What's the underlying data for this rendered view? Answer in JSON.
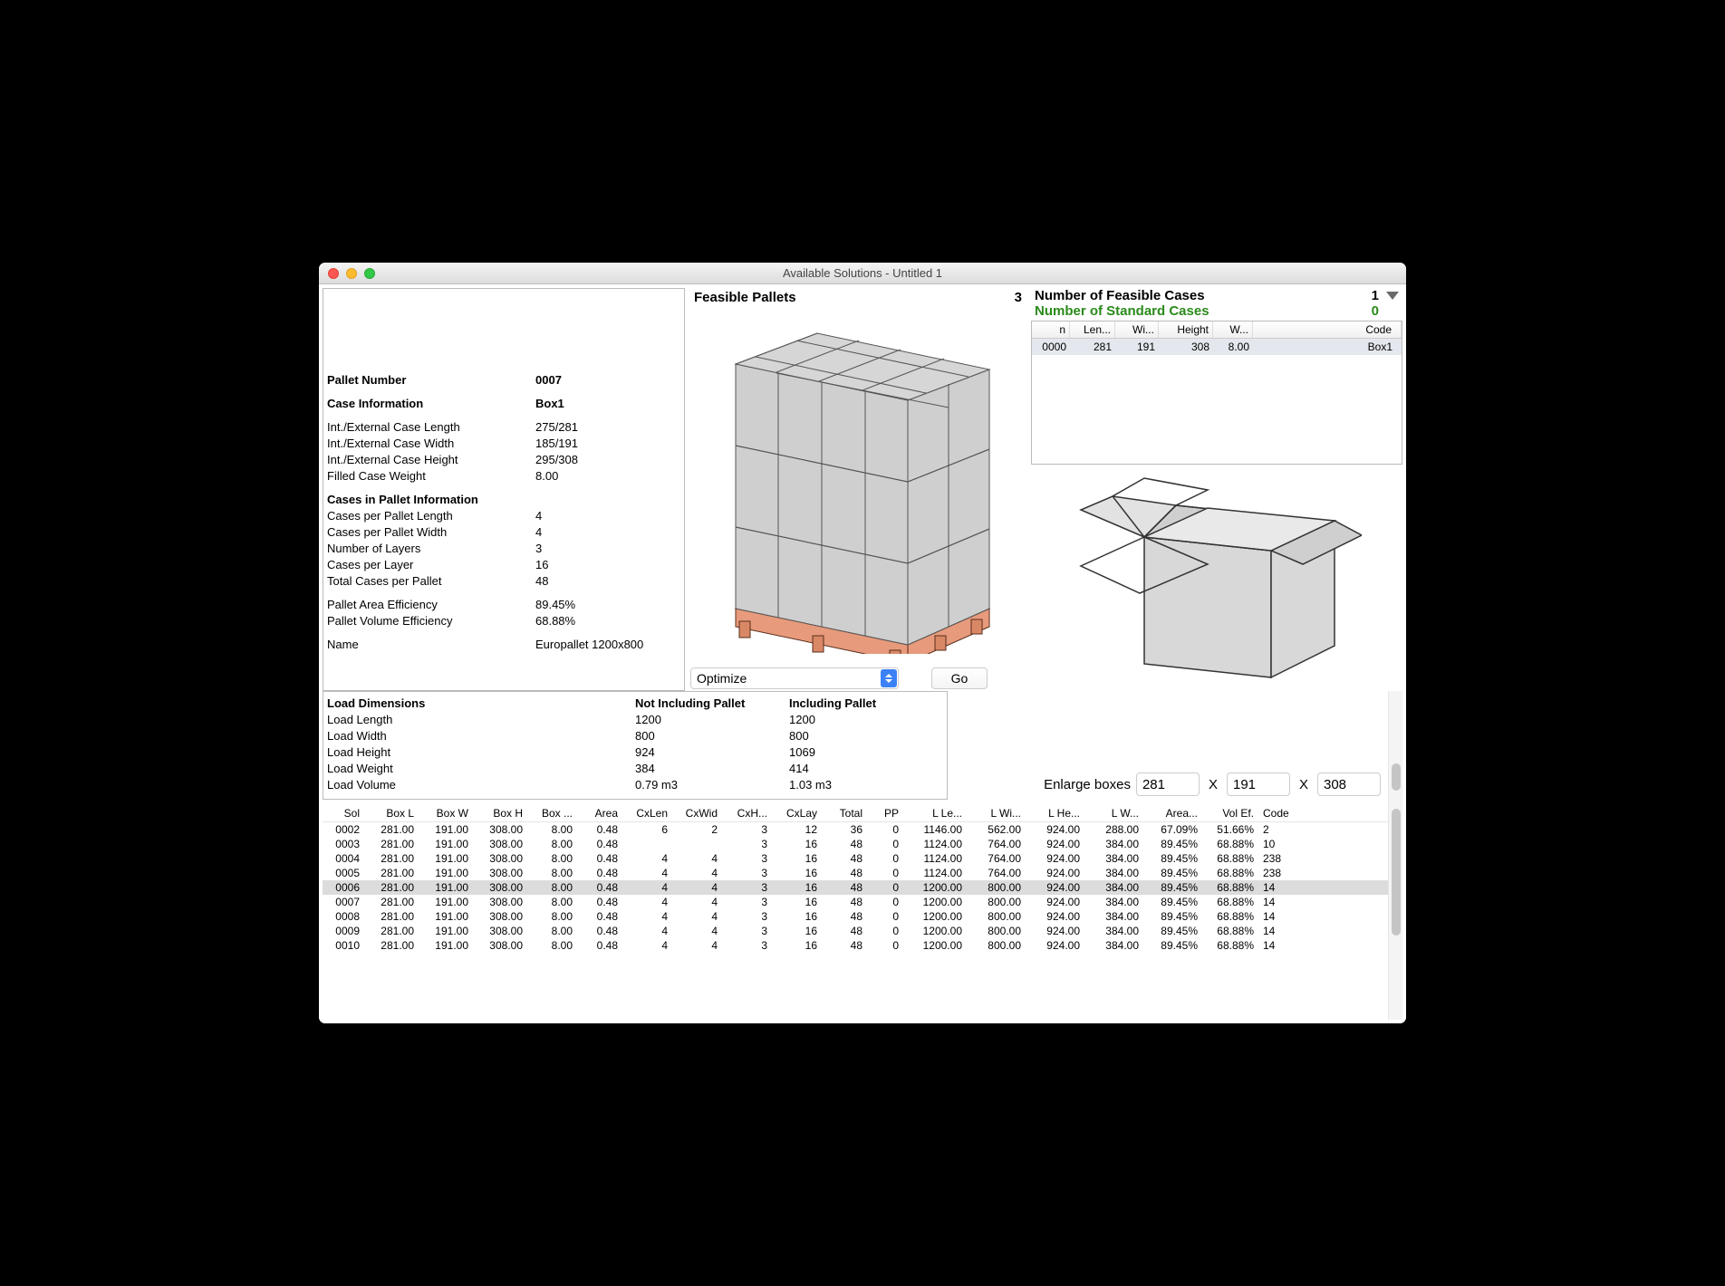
{
  "window_title": "Available Solutions - Untitled 1",
  "left": {
    "pallet_number_label": "Pallet Number",
    "pallet_number": "0007",
    "case_info_label": "Case Information",
    "case_name": "Box1",
    "fields": {
      "len_l": "Int./External Case Length",
      "len_v": "275/281",
      "wid_l": "Int./External Case Width",
      "wid_v": "185/191",
      "hei_l": "Int./External Case Height",
      "hei_v": "295/308",
      "fw_l": "Filled Case Weight",
      "fw_v": "8.00"
    },
    "cases_in_pallet_label": "Cases in Pallet Information",
    "cpl_l": "Cases per Pallet Length",
    "cpl_v": "4",
    "cpw_l": "Cases per Pallet Width",
    "cpw_v": "4",
    "nol_l": "Number of Layers",
    "nol_v": "3",
    "cplay_l": "Cases per Layer",
    "cplay_v": "16",
    "tcp_l": "Total Cases per Pallet",
    "tcp_v": "48",
    "pae_l": "Pallet Area Efficiency",
    "pae_v": "89.45%",
    "pve_l": "Pallet Volume Efficiency",
    "pve_v": "68.88%",
    "name_l": "Name",
    "name_v": "Europallet 1200x800"
  },
  "mid": {
    "header": "Feasible Pallets",
    "count": "3",
    "optimize": "Optimize",
    "go": "Go"
  },
  "right": {
    "feasible_cases_l": "Number of Feasible Cases",
    "feasible_cases_v": "1",
    "standard_cases_l": "Number of Standard Cases",
    "standard_cases_v": "0",
    "th": {
      "n": "n",
      "len": "Len...",
      "wi": "Wi...",
      "hei": "Height",
      "w": "W...",
      "code": "Code"
    },
    "row": {
      "n": "0000",
      "len": "281",
      "wi": "191",
      "hei": "308",
      "w": "8.00",
      "code": "Box1"
    }
  },
  "enlarge": {
    "label": "Enlarge boxes",
    "l": "281",
    "w": "191",
    "h": "308"
  },
  "load": {
    "h": "Load Dimensions",
    "h1": "Not Including Pallet",
    "h2": "Including Pallet",
    "ll": "Load Length",
    "l1": "1200",
    "l2": "1200",
    "wl": "Load Width",
    "w1": "800",
    "w2": "800",
    "hl": "Load Height",
    "he1": "924",
    "he2": "1069",
    "wtl": "Load Weight",
    "wt1": "384",
    "wt2": "414",
    "vl": "Load Volume",
    "v1": "0.79 m3",
    "v2": "1.03 m3"
  },
  "sol_headers": [
    "Sol",
    "Box L",
    "Box W",
    "Box H",
    "Box ...",
    "Area",
    "CxLen",
    "CxWid",
    "CxH...",
    "CxLay",
    "Total",
    "PP",
    "L Le...",
    "L Wi...",
    "L He...",
    "L W...",
    "Area...",
    "Vol Ef.",
    "Code"
  ],
  "sol_rows": [
    {
      "sel": false,
      "c": [
        "0002",
        "281.00",
        "191.00",
        "308.00",
        "8.00",
        "0.48",
        "6",
        "2",
        "3",
        "12",
        "36",
        "0",
        "1146.00",
        "562.00",
        "924.00",
        "288.00",
        "67.09%",
        "51.66%",
        "2"
      ]
    },
    {
      "sel": false,
      "c": [
        "0003",
        "281.00",
        "191.00",
        "308.00",
        "8.00",
        "0.48",
        "",
        "",
        "3",
        "16",
        "48",
        "0",
        "1124.00",
        "764.00",
        "924.00",
        "384.00",
        "89.45%",
        "68.88%",
        "10"
      ]
    },
    {
      "sel": false,
      "c": [
        "0004",
        "281.00",
        "191.00",
        "308.00",
        "8.00",
        "0.48",
        "4",
        "4",
        "3",
        "16",
        "48",
        "0",
        "1124.00",
        "764.00",
        "924.00",
        "384.00",
        "89.45%",
        "68.88%",
        "238"
      ]
    },
    {
      "sel": false,
      "c": [
        "0005",
        "281.00",
        "191.00",
        "308.00",
        "8.00",
        "0.48",
        "4",
        "4",
        "3",
        "16",
        "48",
        "0",
        "1124.00",
        "764.00",
        "924.00",
        "384.00",
        "89.45%",
        "68.88%",
        "238"
      ]
    },
    {
      "sel": true,
      "c": [
        "0006",
        "281.00",
        "191.00",
        "308.00",
        "8.00",
        "0.48",
        "4",
        "4",
        "3",
        "16",
        "48",
        "0",
        "1200.00",
        "800.00",
        "924.00",
        "384.00",
        "89.45%",
        "68.88%",
        "14"
      ]
    },
    {
      "sel": false,
      "c": [
        "0007",
        "281.00",
        "191.00",
        "308.00",
        "8.00",
        "0.48",
        "4",
        "4",
        "3",
        "16",
        "48",
        "0",
        "1200.00",
        "800.00",
        "924.00",
        "384.00",
        "89.45%",
        "68.88%",
        "14"
      ]
    },
    {
      "sel": false,
      "c": [
        "0008",
        "281.00",
        "191.00",
        "308.00",
        "8.00",
        "0.48",
        "4",
        "4",
        "3",
        "16",
        "48",
        "0",
        "1200.00",
        "800.00",
        "924.00",
        "384.00",
        "89.45%",
        "68.88%",
        "14"
      ]
    },
    {
      "sel": false,
      "c": [
        "0009",
        "281.00",
        "191.00",
        "308.00",
        "8.00",
        "0.48",
        "4",
        "4",
        "3",
        "16",
        "48",
        "0",
        "1200.00",
        "800.00",
        "924.00",
        "384.00",
        "89.45%",
        "68.88%",
        "14"
      ]
    },
    {
      "sel": false,
      "c": [
        "0010",
        "281.00",
        "191.00",
        "308.00",
        "8.00",
        "0.48",
        "4",
        "4",
        "3",
        "16",
        "48",
        "0",
        "1200.00",
        "800.00",
        "924.00",
        "384.00",
        "89.45%",
        "68.88%",
        "14"
      ]
    }
  ]
}
